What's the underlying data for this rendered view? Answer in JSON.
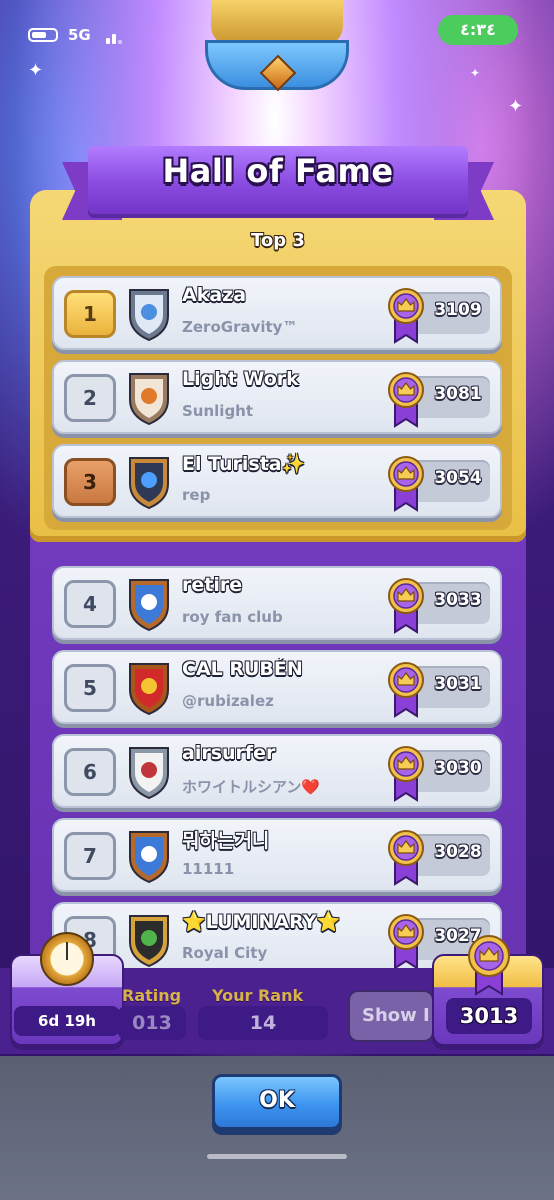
{
  "status_bar": {
    "network": "5G",
    "time": "٤:٣٤"
  },
  "header": {
    "title": "Hall of Fame",
    "section_label": "Top 3"
  },
  "leaderboard": [
    {
      "rank": "1",
      "name": "Akaza",
      "clan": "ZeroGravity™",
      "trophies": "3109",
      "badge": "blue-star-shield-icon",
      "rank_style": "gold"
    },
    {
      "rank": "2",
      "name": "Light Work",
      "clan": "Sunlight",
      "trophies": "3081",
      "badge": "orange-star-shield-icon",
      "rank_style": "silver"
    },
    {
      "rank": "3",
      "name": "El Turista✨",
      "clan": "rep",
      "trophies": "3054",
      "badge": "sword-shield-icon",
      "rank_style": "bronze"
    },
    {
      "rank": "4",
      "name": "retire",
      "clan": "roy fan club",
      "trophies": "3033",
      "badge": "heart-shield-icon",
      "rank_style": "plain"
    },
    {
      "rank": "5",
      "name": "CAL RUBÉN",
      "clan": "@rubizalez",
      "trophies": "3031",
      "badge": "spain-flag-shield-icon",
      "rank_style": "plain"
    },
    {
      "rank": "6",
      "name": "airsurfer",
      "clan": "ホワイトルシアン❤️",
      "trophies": "3030",
      "badge": "lotus-shield-icon",
      "rank_style": "plain"
    },
    {
      "rank": "7",
      "name": "뭐하는거니",
      "clan": "11111",
      "trophies": "3028",
      "badge": "heart-shield-icon",
      "rank_style": "plain"
    },
    {
      "rank": "8",
      "name": "⭐LUMINARY⭐",
      "clan": "Royal City",
      "trophies": "3027",
      "badge": "clover-shield-icon",
      "rank_style": "plain"
    }
  ],
  "footer_stats": {
    "season_timer": "6d 19h",
    "rating_label": "Rating",
    "rating_value": "013",
    "your_rank_label": "Your Rank",
    "your_rank_value": "14",
    "show_button_label": "Show I",
    "my_trophies": "3013"
  },
  "ok_button_label": "OK",
  "colors": {
    "panel_purple": "#7a3fc8",
    "panel_gold": "#f5d775",
    "ok_blue": "#3e95f0",
    "status_green": "#4ccc5d"
  }
}
